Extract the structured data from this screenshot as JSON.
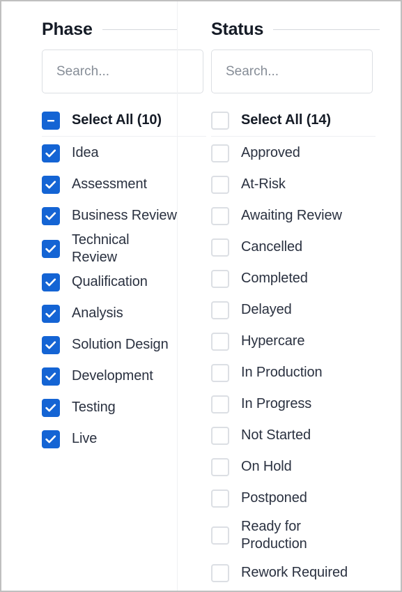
{
  "panel": {
    "accent_color": "#1464d4",
    "checkbox_border_color": "#dcdfe4",
    "text_color": "#2a3140",
    "rule_color": "#d5d8dd"
  },
  "columns": [
    {
      "key": "phase",
      "title": "Phase",
      "search": {
        "placeholder": "Search...",
        "value": ""
      },
      "select_all": {
        "label": "Select All (10)",
        "state": "indeterminate",
        "count": 10
      },
      "options": [
        {
          "label": "Idea",
          "checked": true
        },
        {
          "label": "Assessment",
          "checked": true
        },
        {
          "label": "Business Review",
          "checked": true
        },
        {
          "label": "Technical Review",
          "checked": true
        },
        {
          "label": "Qualification",
          "checked": true
        },
        {
          "label": "Analysis",
          "checked": true
        },
        {
          "label": "Solution Design",
          "checked": true
        },
        {
          "label": "Development",
          "checked": true
        },
        {
          "label": "Testing",
          "checked": true
        },
        {
          "label": "Live",
          "checked": true
        }
      ]
    },
    {
      "key": "status",
      "title": "Status",
      "search": {
        "placeholder": "Search...",
        "value": ""
      },
      "select_all": {
        "label": "Select All (14)",
        "state": "unchecked",
        "count": 14
      },
      "options": [
        {
          "label": "Approved",
          "checked": false
        },
        {
          "label": "At-Risk",
          "checked": false
        },
        {
          "label": "Awaiting Review",
          "checked": false
        },
        {
          "label": "Cancelled",
          "checked": false
        },
        {
          "label": "Completed",
          "checked": false
        },
        {
          "label": "Delayed",
          "checked": false
        },
        {
          "label": "Hypercare",
          "checked": false
        },
        {
          "label": "In Production",
          "checked": false
        },
        {
          "label": "In Progress",
          "checked": false
        },
        {
          "label": "Not Started",
          "checked": false
        },
        {
          "label": "On Hold",
          "checked": false
        },
        {
          "label": "Postponed",
          "checked": false
        },
        {
          "label": "Ready for Production",
          "checked": false,
          "wrapped": true
        },
        {
          "label": "Rework Required",
          "checked": false
        }
      ]
    }
  ]
}
